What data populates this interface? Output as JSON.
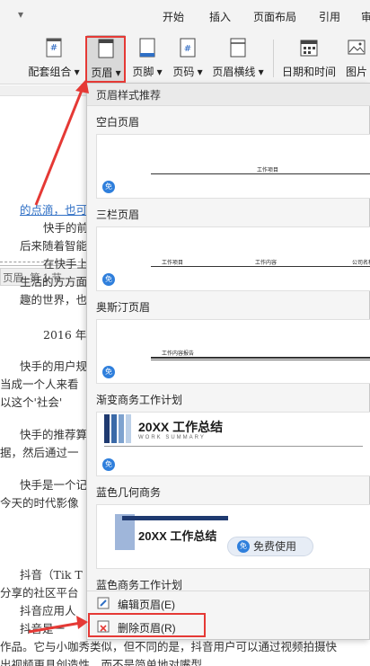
{
  "tabs": {
    "qa_icon": "quick-access-chevron-icon",
    "items": [
      {
        "label": "开始"
      },
      {
        "label": "插入"
      },
      {
        "label": "页面布局"
      },
      {
        "label": "引用"
      },
      {
        "label": "审"
      }
    ]
  },
  "ribbon": {
    "combo": "配套组合 ▾",
    "header": "页眉 ▾",
    "footer": "页脚 ▾",
    "pagenum": "页码 ▾",
    "hline": "页眉横线 ▾",
    "datetime": "日期和时间",
    "picture": "图片"
  },
  "document": {
    "header_tag": "页眉 -第 1 节-",
    "lines": [
      {
        "text": "的点滴，也可"
      },
      {
        "text": "快手的前身"
      },
      {
        "text": "后来随着智能"
      },
      {
        "text": "在快手上"
      },
      {
        "text": "生活的方方面"
      },
      {
        "text": "趣的世界，也"
      },
      {
        "text": "2016 年"
      },
      {
        "text": "快手的用户规"
      },
      {
        "text": "当成一个人来看"
      },
      {
        "text": "以这个'社会'"
      },
      {
        "text": "快手的推荐算"
      },
      {
        "text": "据，然后通过一"
      },
      {
        "text": "快手是一个记"
      },
      {
        "text": "今天的时代影像"
      },
      {
        "text": "抖音（Tik T"
      },
      {
        "text": "分享的社区平台"
      },
      {
        "text": "抖音应用人"
      },
      {
        "text": "抖音是一"
      },
      {
        "text": "作品。它与小咖秀类似，但不同的是，抖音用户可以通过视频拍摄快"
      },
      {
        "text": "出视频更具创造性，而不是简单地对嘴型"
      }
    ]
  },
  "dropdown": {
    "title": "页眉样式推荐",
    "templates": [
      {
        "name": "空白页眉",
        "texts": [
          "工作项目"
        ]
      },
      {
        "name": "三栏页眉",
        "texts": [
          "工作项目",
          "工作内容",
          "公司名称"
        ]
      },
      {
        "name": "奥斯汀页眉",
        "texts": [
          "工作内容报告"
        ]
      },
      {
        "name": "渐变商务工作计划",
        "texts": [
          "20XX 工作总结",
          "WORK SUMMARY"
        ]
      },
      {
        "name": "蓝色几何商务",
        "texts": [
          "20XX 工作总结"
        ]
      },
      {
        "name": "蓝色商务工作计划"
      }
    ],
    "free_badge": "免",
    "free_use": "免费使用",
    "menu": {
      "edit": "编辑页眉(E)",
      "delete": "删除页眉(R)"
    }
  },
  "colors": {
    "accent_red": "#e53935",
    "link_blue": "#2f6fc5",
    "badge_blue": "#2f7fdc",
    "navy": "#1f3a70"
  }
}
